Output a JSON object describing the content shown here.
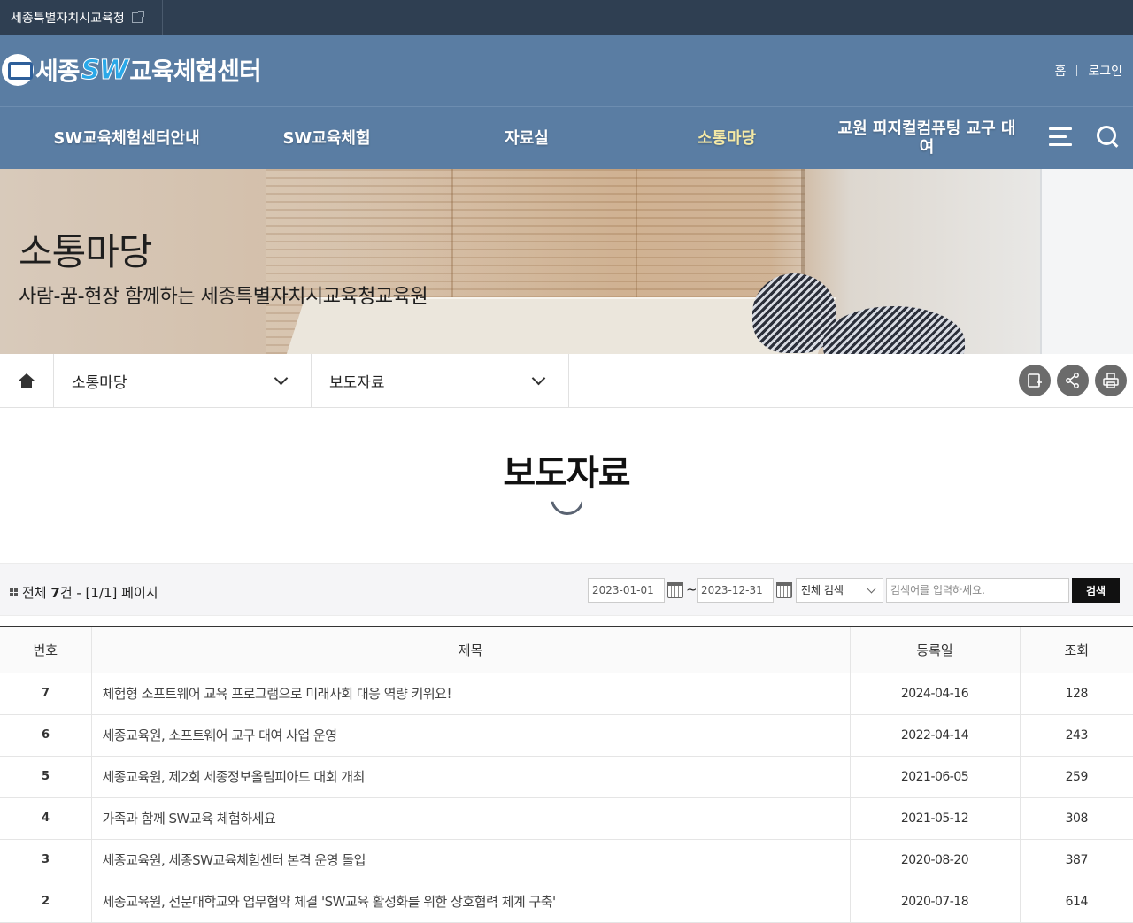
{
  "topbar": {
    "org_link": "세종특별자치시교육청",
    "external_icon": "external-link-icon"
  },
  "header": {
    "logo": {
      "part1": "세종",
      "part2": "SW",
      "part3": "교육체험센터"
    },
    "util": {
      "home": "홈",
      "login": "로그인"
    }
  },
  "nav": {
    "items": [
      {
        "label": "SW교육체험센터안내"
      },
      {
        "label": "SW교육체험"
      },
      {
        "label": "자료실"
      },
      {
        "label": "소통마당"
      },
      {
        "label": "교원 피지컬컴퓨팅 교구 대여"
      }
    ],
    "active_color": "#f4e9a6",
    "menu_icon": "hamburger-icon",
    "search_icon": "search-icon"
  },
  "hero": {
    "title": "소통마당",
    "subtitle": "사람-꿈-현장 함께하는 세종특별자치시교육청교육원"
  },
  "breadcrumb": {
    "home_icon": "home-icon",
    "level1": "소통마당",
    "level2": "보도자료",
    "tools": [
      "add-bookmark-icon",
      "share-icon",
      "print-icon"
    ]
  },
  "page": {
    "title": "보도자료"
  },
  "search": {
    "total_prefix": "전체 ",
    "total_count": "7",
    "total_suffix": "건 - [1/1] 페이지",
    "date_from": "2023-01-01",
    "date_to": "2023-12-31",
    "tilde": "~",
    "scope": "전체 검색",
    "keyword_placeholder": "검색어를 입력하세요.",
    "button": "검색"
  },
  "board": {
    "headers": {
      "no": "번호",
      "title": "제목",
      "date": "등록일",
      "views": "조회"
    },
    "rows": [
      {
        "no": "7",
        "title": "체험형 소프트웨어 교육 프로그램으로 미래사회 대응 역량 키워요!",
        "date": "2024-04-16",
        "views": "128"
      },
      {
        "no": "6",
        "title": "세종교육원, 소프트웨어 교구 대여 사업 운영",
        "date": "2022-04-14",
        "views": "243"
      },
      {
        "no": "5",
        "title": "세종교육원, 제2회 세종정보올림피아드 대회 개최",
        "date": "2021-06-05",
        "views": "259"
      },
      {
        "no": "4",
        "title": "가족과 함께 SW교육 체험하세요",
        "date": "2021-05-12",
        "views": "308"
      },
      {
        "no": "3",
        "title": "세종교육원, 세종SW교육체험센터 본격 운영 돌입",
        "date": "2020-08-20",
        "views": "387"
      },
      {
        "no": "2",
        "title": "세종교육원, 선문대학교와 업무협약 체결 'SW교육 활성화를 위한 상호협력 체계 구축'",
        "date": "2020-07-18",
        "views": "614"
      }
    ]
  }
}
